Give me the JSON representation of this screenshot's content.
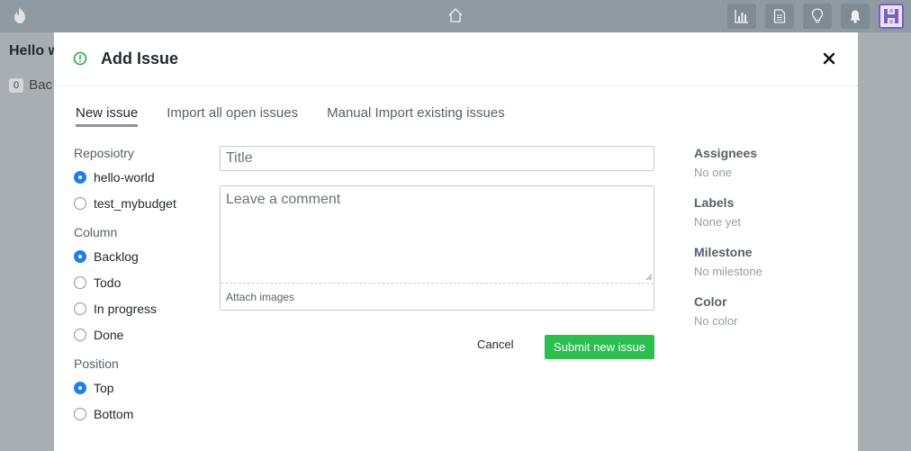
{
  "topbar": {
    "flame_icon": "flame-icon",
    "home_icon": "home-icon",
    "buttons": [
      "chart-icon",
      "document-icon",
      "lightbulb-icon",
      "bell-icon"
    ],
    "avatar_icon": "avatar-icon"
  },
  "background": {
    "title": "Hello w",
    "count": "0",
    "column_label": "Bac"
  },
  "modal": {
    "title": "Add Issue",
    "tabs": [
      {
        "label": "New issue"
      },
      {
        "label": "Import all open issues"
      },
      {
        "label": "Manual Import existing issues"
      }
    ],
    "repository": {
      "label": "Reposiotry",
      "options": [
        {
          "label": "hello-world",
          "checked": true
        },
        {
          "label": "test_mybudget",
          "checked": false
        }
      ]
    },
    "column": {
      "label": "Column",
      "options": [
        {
          "label": "Backlog",
          "checked": true
        },
        {
          "label": "Todo",
          "checked": false
        },
        {
          "label": "In progress",
          "checked": false
        },
        {
          "label": "Done",
          "checked": false
        }
      ]
    },
    "position": {
      "label": "Position",
      "options": [
        {
          "label": "Top",
          "checked": true
        },
        {
          "label": "Bottom",
          "checked": false
        }
      ]
    },
    "form": {
      "title_placeholder": "Title",
      "comment_placeholder": "Leave a comment",
      "attach_label": "Attach images",
      "cancel_label": "Cancel",
      "submit_label": "Submit new issue"
    },
    "sidebar": [
      {
        "label": "Assignees",
        "value": "No one"
      },
      {
        "label": "Labels",
        "value": "None yet"
      },
      {
        "label": "Milestone",
        "value": "No milestone"
      },
      {
        "label": "Color",
        "value": "No color"
      }
    ]
  },
  "colors": {
    "accent": "#1f7ff1",
    "submit": "#2cbe4e",
    "topbar": "#8f9aa3",
    "avatar_border": "#7b5fc7"
  }
}
